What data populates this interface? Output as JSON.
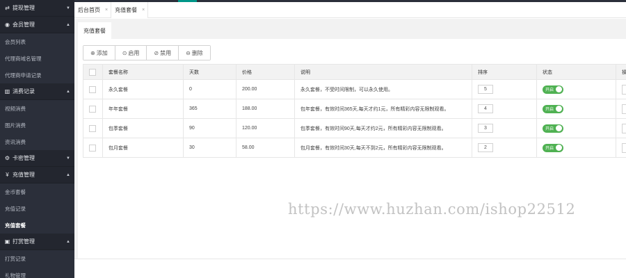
{
  "sidebar": {
    "groups": [
      {
        "icon": "⇄",
        "icon_name": "exchange-icon",
        "label": "提现管理",
        "expanded": false,
        "items": []
      },
      {
        "icon": "◉",
        "icon_name": "user-circle-icon",
        "label": "会员管理",
        "expanded": true,
        "items": [
          {
            "label": "会员列表"
          },
          {
            "label": "代理商域名管理"
          },
          {
            "label": "代理商申请记录"
          }
        ]
      },
      {
        "icon": "▥",
        "icon_name": "bar-chart-icon",
        "label": "消费记录",
        "expanded": true,
        "items": [
          {
            "label": "视频消费"
          },
          {
            "label": "图片消费"
          },
          {
            "label": "资讯消费"
          }
        ]
      },
      {
        "icon": "⚙",
        "icon_name": "gear-icon",
        "label": "卡密管理",
        "expanded": false,
        "items": []
      },
      {
        "icon": "¥",
        "icon_name": "yen-icon",
        "label": "充值管理",
        "expanded": true,
        "items": [
          {
            "label": "金币套餐"
          },
          {
            "label": "充值记录"
          },
          {
            "label": "充值套餐",
            "active": true
          }
        ]
      },
      {
        "icon": "▣",
        "icon_name": "gift-box-icon",
        "label": "打赏管理",
        "expanded": true,
        "items": [
          {
            "label": "打赏记录"
          },
          {
            "label": "礼物管理"
          }
        ]
      }
    ]
  },
  "tabs": [
    {
      "label": "后台首页",
      "close": "×",
      "active": false
    },
    {
      "label": "充值套餐",
      "close": "×",
      "active": true
    }
  ],
  "subtab": {
    "label": "充值套餐"
  },
  "toolbar": {
    "add": {
      "icon": "⊕",
      "label": "添加"
    },
    "enable": {
      "icon": "⊙",
      "label": "启用"
    },
    "disable": {
      "icon": "⊘",
      "label": "禁用"
    },
    "delete": {
      "icon": "⊖",
      "label": "删除"
    }
  },
  "table": {
    "headers": {
      "name": "套餐名称",
      "days": "天数",
      "price": "价格",
      "desc": "说明",
      "sort": "排序",
      "status": "状态",
      "ops": "操"
    },
    "rows": [
      {
        "name": "永久套餐",
        "days": "0",
        "price": "200.00",
        "desc": "永久套餐，不受时间限制，可以永久使用。",
        "sort": "5",
        "status": "开启"
      },
      {
        "name": "年年套餐",
        "days": "365",
        "price": "188.00",
        "desc": "包年套餐，有效时间365天,每天才约1元，所有精彩内容无限制观看。",
        "sort": "4",
        "status": "开启"
      },
      {
        "name": "包季套餐",
        "days": "90",
        "price": "120.00",
        "desc": "包季套餐，有效时间90天,每天才约2元，所有精彩内容无限制观看。",
        "sort": "3",
        "status": "开启"
      },
      {
        "name": "包月套餐",
        "days": "30",
        "price": "58.00",
        "desc": "包月套餐，有效时间30天,每天不到2元，所有精彩内容无限制观看。",
        "sort": "2",
        "status": "开启"
      }
    ]
  },
  "watermark": "https://www.huzhan.com/ishop22512",
  "colors": {
    "sidebar_bg": "#2b2f3a",
    "accent": "#009688",
    "switch_on": "#4fb152"
  }
}
